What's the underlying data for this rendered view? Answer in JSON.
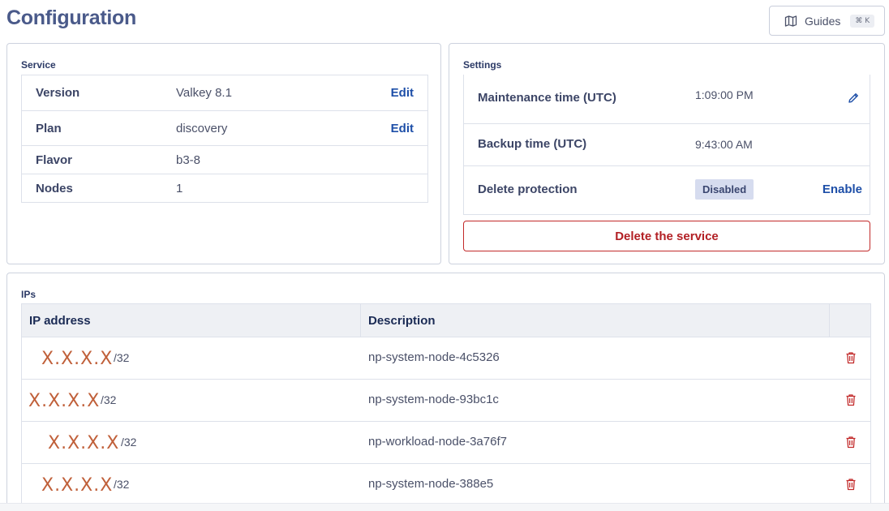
{
  "page": {
    "title": "Configuration"
  },
  "guides": {
    "label": "Guides",
    "shortcut": "⌘ K",
    "icon": "map-icon"
  },
  "service": {
    "title": "Service",
    "rows": [
      {
        "key": "Version",
        "value": "Valkey 8.1",
        "action": "Edit"
      },
      {
        "key": "Plan",
        "value": "discovery",
        "action": "Edit"
      },
      {
        "key": "Flavor",
        "value": "b3-8"
      },
      {
        "key": "Nodes",
        "value": "1"
      }
    ]
  },
  "settings": {
    "title": "Settings",
    "maintenance": {
      "key": "Maintenance time (UTC)",
      "value": "1:09:00 PM",
      "icon": "pencil-icon"
    },
    "backup": {
      "key": "Backup time (UTC)",
      "value": "9:43:00 AM"
    },
    "protection": {
      "key": "Delete protection",
      "badge": "Disabled",
      "action": "Enable"
    },
    "delete_label": "Delete the service"
  },
  "ips": {
    "title": "IPs",
    "columns": [
      "IP address",
      "Description"
    ],
    "rows": [
      {
        "address": "X.X.X.X",
        "mask": "/32",
        "description": "np-system-node-4c5326"
      },
      {
        "address": "X.X.X.X",
        "mask": "/32",
        "description": "np-system-node-93bc1c"
      },
      {
        "address": "X.X.X.X",
        "mask": "/32",
        "description": "np-workload-node-3a76f7"
      },
      {
        "address": "X.X.X.X",
        "mask": "/32",
        "description": "np-system-node-388e5"
      }
    ]
  },
  "colors": {
    "accent": "#1e4fa8",
    "danger": "#b21f24",
    "title": "#4a5a8a"
  }
}
